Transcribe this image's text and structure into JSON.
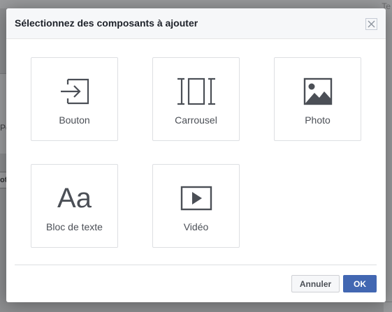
{
  "background_page": {
    "left_text": "Po",
    "left_button_text": "ot",
    "right_text": "Te"
  },
  "dialog": {
    "title": "Sélectionnez des composants à ajouter",
    "close_icon": "close-icon",
    "components": [
      {
        "label": "Bouton",
        "icon": "arrow-into-box-icon"
      },
      {
        "label": "Carrousel",
        "icon": "carousel-icon"
      },
      {
        "label": "Photo",
        "icon": "photo-icon"
      },
      {
        "label": "Bloc de texte",
        "icon": "text-block-icon",
        "glyph": "Aa"
      },
      {
        "label": "Vidéo",
        "icon": "video-play-icon"
      }
    ],
    "buttons": {
      "cancel": "Annuler",
      "ok": "OK"
    }
  },
  "colors": {
    "accent": "#4267b2",
    "icon": "#4b4f56",
    "title": "#1d2129"
  }
}
